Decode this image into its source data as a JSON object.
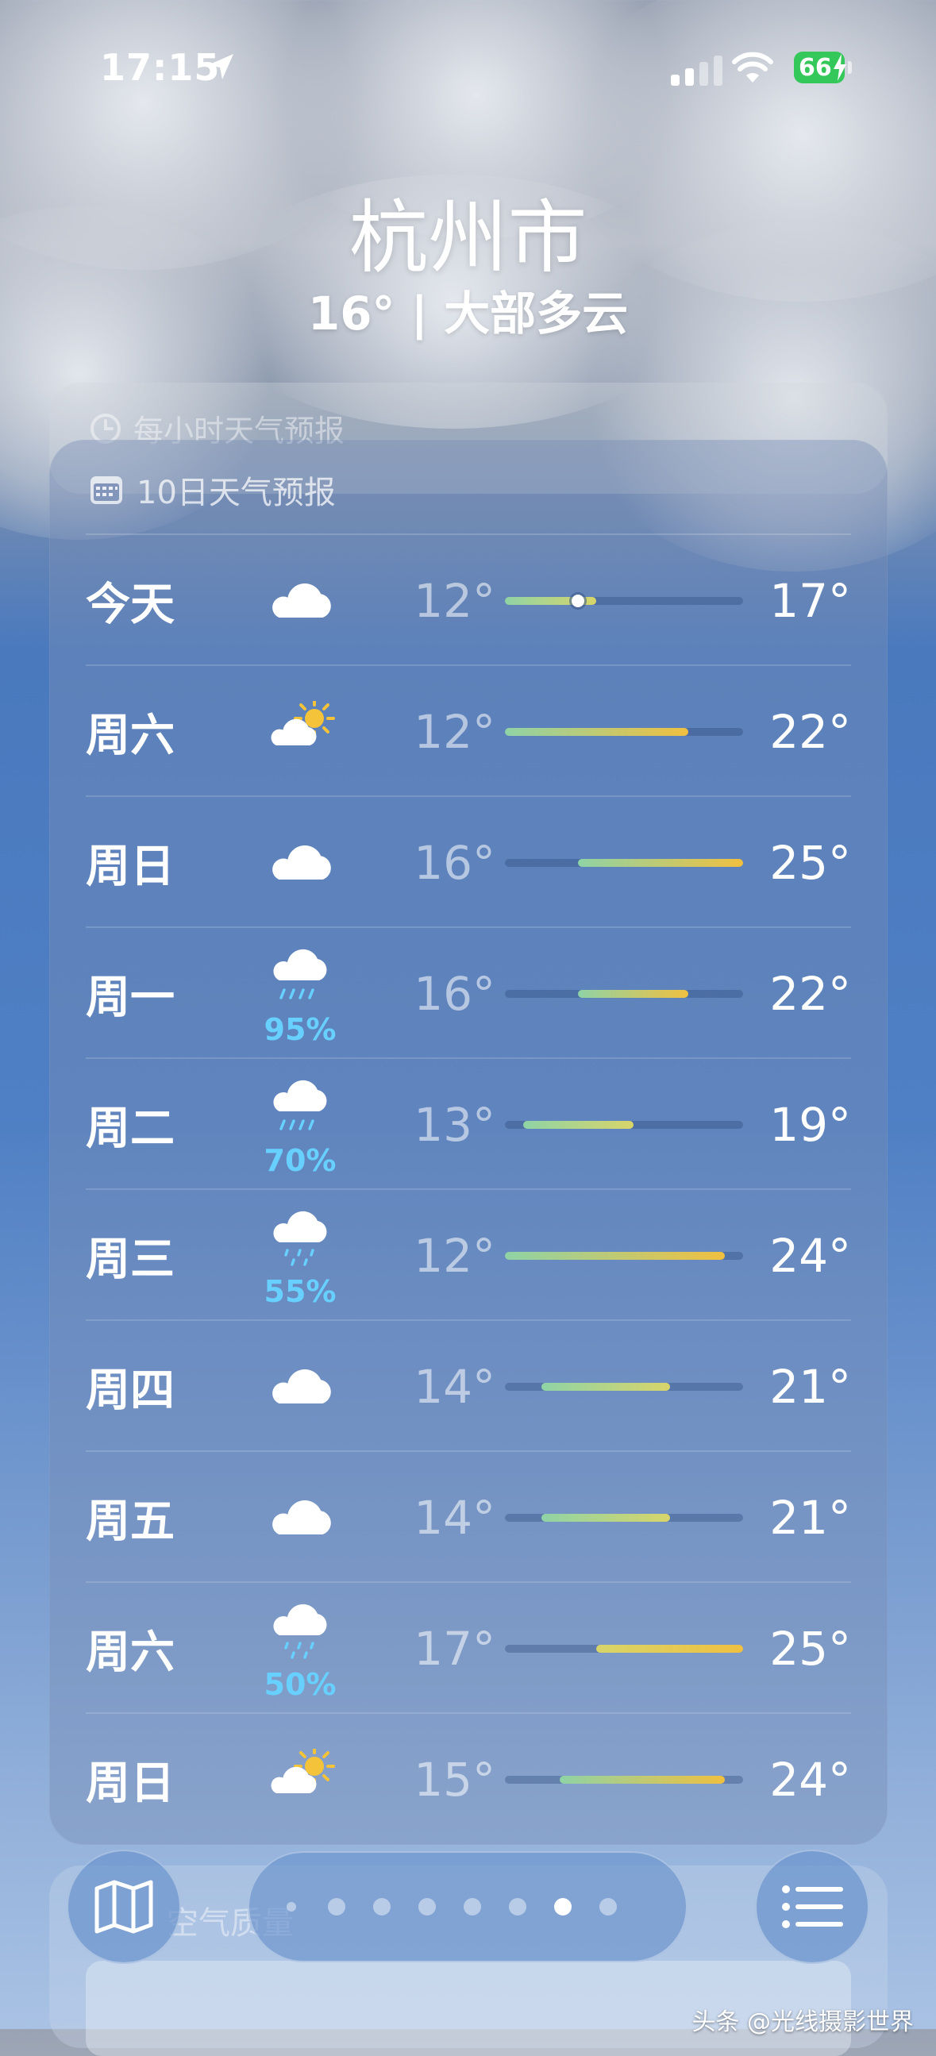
{
  "status_bar": {
    "time": "17:15",
    "battery": "66"
  },
  "header": {
    "city": "杭州市",
    "summary": "16° | 大部多云"
  },
  "hourly": {
    "title": "每小时天气预报"
  },
  "forecast": {
    "title": "10日天气预报",
    "range_min": 12,
    "range_max": 25,
    "days": [
      {
        "day": "今天",
        "icon": "cloud-icon",
        "precip": "",
        "low": "12°",
        "high": "17°",
        "low_val": 12,
        "high_val": 17,
        "current_val": 16
      },
      {
        "day": "周六",
        "icon": "sun-cloud-icon",
        "precip": "",
        "low": "12°",
        "high": "22°",
        "low_val": 12,
        "high_val": 22
      },
      {
        "day": "周日",
        "icon": "cloud-icon",
        "precip": "",
        "low": "16°",
        "high": "25°",
        "low_val": 16,
        "high_val": 25
      },
      {
        "day": "周一",
        "icon": "rain-cloud-icon",
        "precip": "95%",
        "low": "16°",
        "high": "22°",
        "low_val": 16,
        "high_val": 22
      },
      {
        "day": "周二",
        "icon": "rain-cloud-icon",
        "precip": "70%",
        "low": "13°",
        "high": "19°",
        "low_val": 13,
        "high_val": 19
      },
      {
        "day": "周三",
        "icon": "drizzle-cloud-icon",
        "precip": "55%",
        "low": "12°",
        "high": "24°",
        "low_val": 12,
        "high_val": 24
      },
      {
        "day": "周四",
        "icon": "cloud-icon",
        "precip": "",
        "low": "14°",
        "high": "21°",
        "low_val": 14,
        "high_val": 21
      },
      {
        "day": "周五",
        "icon": "cloud-icon",
        "precip": "",
        "low": "14°",
        "high": "21°",
        "low_val": 14,
        "high_val": 21
      },
      {
        "day": "周六",
        "icon": "drizzle-cloud-icon",
        "precip": "50%",
        "low": "17°",
        "high": "25°",
        "low_val": 17,
        "high_val": 25
      },
      {
        "day": "周日",
        "icon": "sun-cloud-icon",
        "precip": "",
        "low": "15°",
        "high": "24°",
        "low_val": 15,
        "high_val": 24
      }
    ]
  },
  "air_quality": {
    "title": "空气质量"
  },
  "toolbar": {
    "map_icon": "map-icon",
    "list_icon": "list-icon",
    "page_count": 8,
    "active_page": 7
  },
  "colors": {
    "precip": "#67d0ff",
    "cool": "#8fd3a6",
    "warm": "#f0c040",
    "hot": "#f3a93a"
  },
  "watermark": "头条 @光线摄影世界"
}
